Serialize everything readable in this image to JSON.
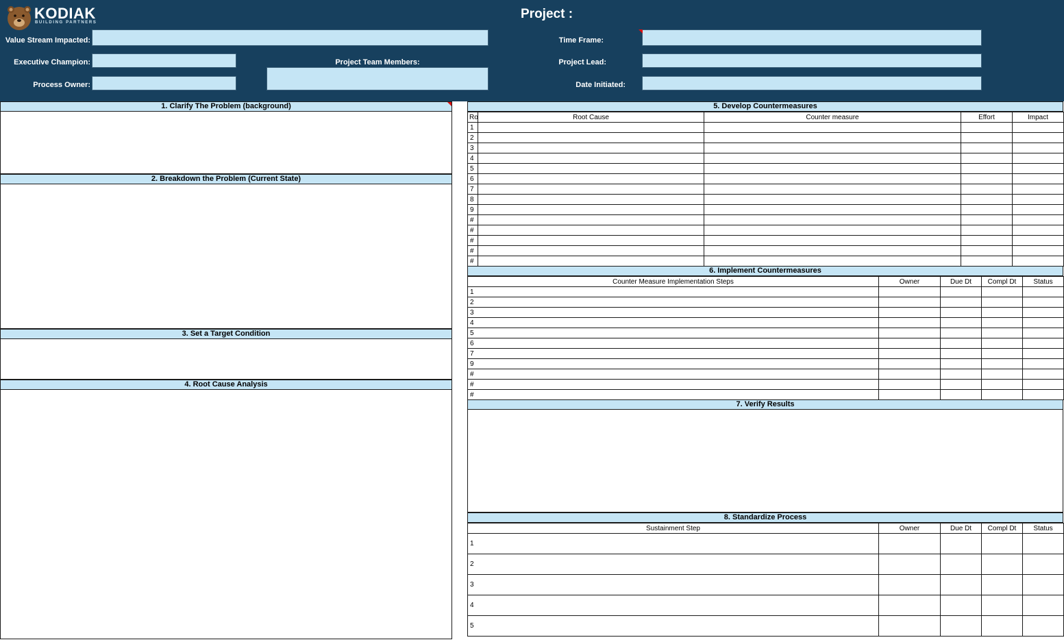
{
  "brand": {
    "name": "KODIAK",
    "tagline": "BUILDING PARTNERS"
  },
  "header": {
    "project_label": "Project :",
    "value_stream_label": "Value Stream Impacted:",
    "executive_champion_label": "Executive Champion:",
    "process_owner_label": "Process Owner:",
    "team_members_label": "Project Team Members:",
    "time_frame_label": "Time Frame:",
    "project_lead_label": "Project Lead:",
    "date_initiated_label": "Date Initiated:",
    "value_stream_value": "",
    "executive_champion_value": "",
    "process_owner_value": "",
    "team_members_value": "",
    "time_frame_value": "",
    "project_lead_value": "",
    "date_initiated_value": ""
  },
  "sections": {
    "s1": "1. Clarify The Problem (background)",
    "s2": "2. Breakdown the Problem (Current State)",
    "s3": "3. Set a Target Condition",
    "s4": "4. Root Cause Analysis",
    "s5": "5. Develop Countermeasures",
    "s6": "6. Implement Countermeasures",
    "s7": "7. Verify Results",
    "s8": "8. Standardize Process"
  },
  "countermeasures": {
    "columns": [
      "Ro",
      "Root Cause",
      "Counter measure",
      "Effort",
      "Impact"
    ],
    "rows": [
      "1",
      "2",
      "3",
      "4",
      "5",
      "6",
      "7",
      "8",
      "9",
      "#",
      "#",
      "#",
      "#",
      "#"
    ]
  },
  "implement": {
    "columns": [
      "Counter Measure Implementation Steps",
      "Owner",
      "Due Dt",
      "Compl Dt",
      "Status"
    ],
    "rows": [
      "1",
      "2",
      "3",
      "4",
      "5",
      "6",
      "7",
      "9",
      "#",
      "#",
      "#"
    ]
  },
  "standardize": {
    "columns": [
      "Sustainment Step",
      "Owner",
      "Due Dt",
      "Compl Dt",
      "Status"
    ],
    "rows": [
      "1",
      "2",
      "3",
      "4",
      "5"
    ]
  },
  "colors": {
    "header_bg": "#17405e",
    "bar_bg": "#c5e5f5",
    "marker": "#d11111"
  }
}
